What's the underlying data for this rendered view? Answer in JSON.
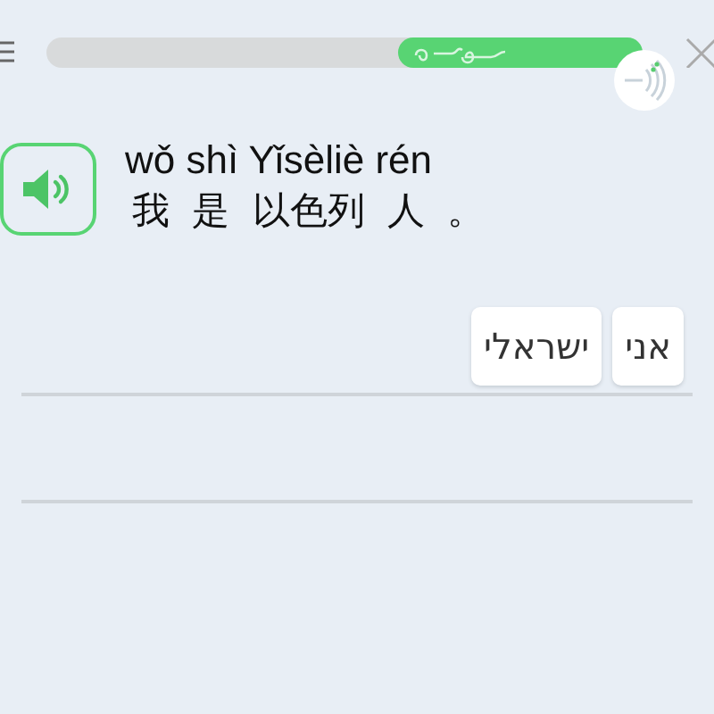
{
  "progress": {
    "level": 0.41
  },
  "prompt": {
    "pinyin": "wǒ shì Yǐsèliè rén",
    "hanzi": "我 是 以色列 人 。"
  },
  "word_bank": [
    {
      "word": "אני"
    },
    {
      "word": "ישראלי"
    }
  ]
}
